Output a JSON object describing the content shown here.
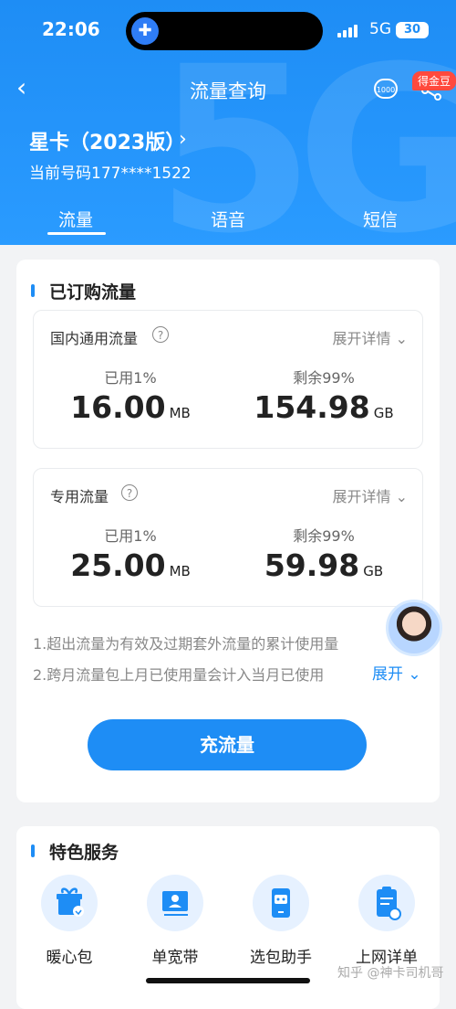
{
  "status": {
    "time": "22:06",
    "network": "5G",
    "battery": "30"
  },
  "nav": {
    "title": "流量查询",
    "badge": "得金豆",
    "points_icon_text": "1000"
  },
  "card": {
    "name": "星卡（2023版）",
    "chevron": "›",
    "number": "当前号码177****1522"
  },
  "tabs": [
    {
      "label": "流量"
    },
    {
      "label": "语音"
    },
    {
      "label": "短信"
    }
  ],
  "subscribed": {
    "title": "已订购流量",
    "boxes": [
      {
        "label": "国内通用流量",
        "expand": "展开详情",
        "used_pct": "已用1%",
        "used_value": "16.00",
        "used_unit": "MB",
        "left_pct": "剩余99%",
        "left_value": "154.98",
        "left_unit": "GB"
      },
      {
        "label": "专用流量",
        "expand": "展开详情",
        "used_pct": "已用1%",
        "used_value": "25.00",
        "used_unit": "MB",
        "left_pct": "剩余99%",
        "left_value": "59.98",
        "left_unit": "GB"
      }
    ],
    "notes": [
      "1.超出流量为有效及过期套外流量的累计使用量",
      "2.跨月流量包上月已使用量会计入当月已使用"
    ],
    "expand_notes": "展开",
    "cta": "充流量"
  },
  "services": {
    "title": "特色服务",
    "items": [
      {
        "label": "暖心包",
        "icon": "gift-icon"
      },
      {
        "label": "单宽带",
        "icon": "broadband-card-icon"
      },
      {
        "label": "选包助手",
        "icon": "robot-phone-icon"
      },
      {
        "label": "上网详单",
        "icon": "clipboard-icon"
      }
    ]
  },
  "watermark": "知乎 @神卡司机哥"
}
